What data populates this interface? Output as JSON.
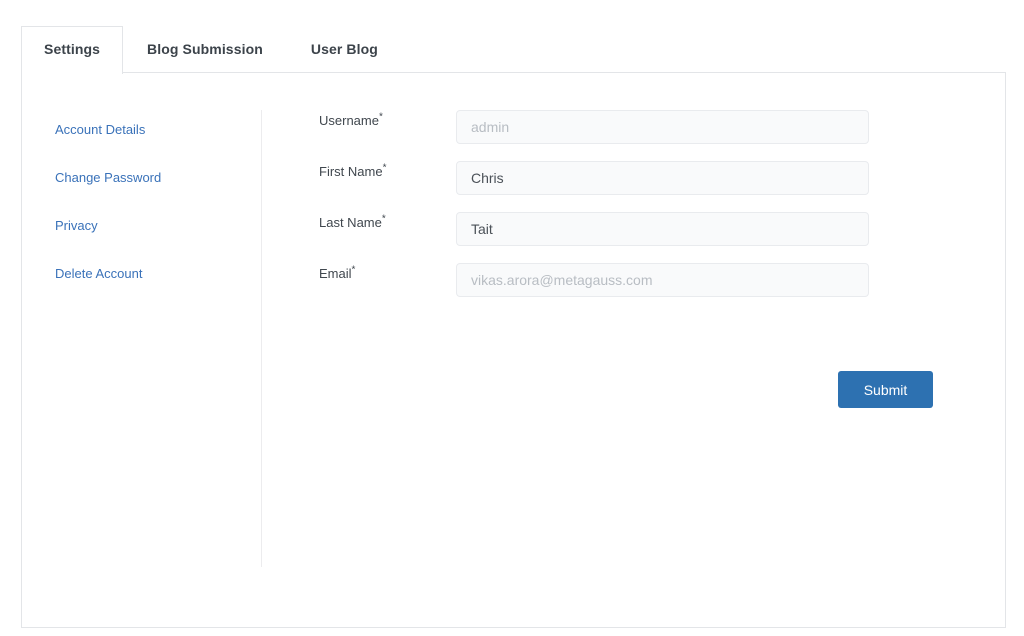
{
  "tabs": [
    {
      "label": "Settings",
      "active": true
    },
    {
      "label": "Blog Submission",
      "active": false
    },
    {
      "label": "User Blog",
      "active": false
    }
  ],
  "sidebar": {
    "items": [
      {
        "label": "Account Details"
      },
      {
        "label": "Change Password"
      },
      {
        "label": "Privacy"
      },
      {
        "label": "Delete Account"
      }
    ]
  },
  "form": {
    "fields": [
      {
        "label": "Username",
        "required_mark": "*",
        "value": "",
        "placeholder": "admin"
      },
      {
        "label": "First Name",
        "required_mark": "*",
        "value": "Chris",
        "placeholder": ""
      },
      {
        "label": "Last Name",
        "required_mark": "*",
        "value": "Tait",
        "placeholder": ""
      },
      {
        "label": "Email",
        "required_mark": "*",
        "value": "",
        "placeholder": "vikas.arora@metagauss.com"
      }
    ],
    "submit_label": "Submit"
  },
  "colors": {
    "link_blue": "#3a72b9",
    "button_blue": "#2d71b1",
    "tab_text": "#3c434a",
    "panel_border": "#e3e5e8",
    "input_bg": "#f9fafb",
    "input_border": "#e9ebee",
    "input_text": "#4b5158",
    "placeholder_text": "#b8bdc3"
  }
}
